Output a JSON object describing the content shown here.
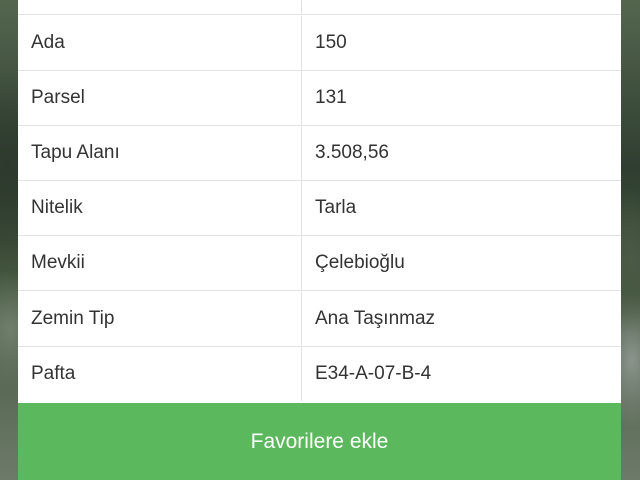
{
  "property_details": {
    "rows": [
      {
        "label": "",
        "value": ""
      },
      {
        "label": "Ada",
        "value": "150"
      },
      {
        "label": "Parsel",
        "value": "131"
      },
      {
        "label": "Tapu Alanı",
        "value": "3.508,56"
      },
      {
        "label": "Nitelik",
        "value": "Tarla"
      },
      {
        "label": "Mevkii",
        "value": "Çelebioğlu"
      },
      {
        "label": "Zemin Tip",
        "value": "Ana Taşınmaz"
      },
      {
        "label": "Pafta",
        "value": "E34-A-07-B-4"
      }
    ]
  },
  "actions": {
    "favorite_label": "Favorilere ekle"
  },
  "colors": {
    "button_bg": "#5cb85c",
    "button_text": "#ffffff",
    "panel_bg": "#ffffff",
    "divider": "#e3e3e3"
  }
}
